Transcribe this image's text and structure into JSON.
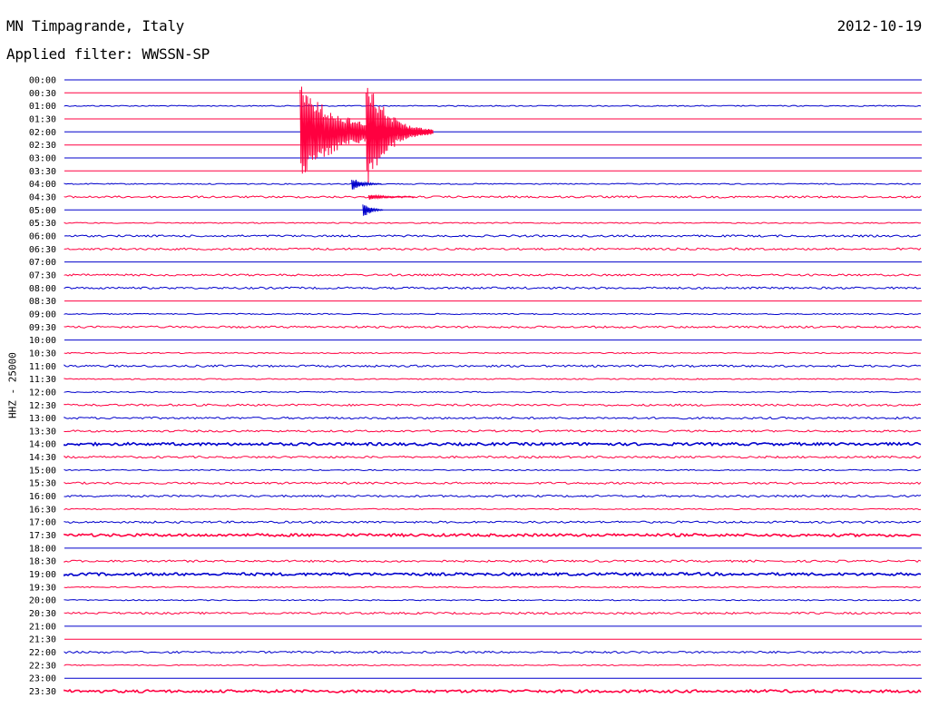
{
  "header": {
    "station": "MN Timpagrande, Italy",
    "date": "2012-10-19",
    "filter": "Applied filter: WWSSN-SP",
    "channel_label": "HHZ - 25000"
  },
  "colors": {
    "blue": "#0000cc",
    "red": "#ff0040"
  },
  "chart_data": {
    "type": "line",
    "title": "MN Timpagrande, Italy",
    "subtitle": "Applied filter: WWSSN-SP",
    "ylabel": "HHZ - 25000",
    "x": [],
    "categories": [
      "00:00",
      "00:30",
      "01:00",
      "01:30",
      "02:00",
      "02:30",
      "03:00",
      "03:30",
      "04:00",
      "04:30",
      "05:00",
      "05:30",
      "06:00",
      "06:30",
      "07:00",
      "07:30",
      "08:00",
      "08:30",
      "09:00",
      "09:30",
      "10:00",
      "10:30",
      "11:00",
      "11:30",
      "12:00",
      "12:30",
      "13:00",
      "13:30",
      "14:00",
      "14:30",
      "15:00",
      "15:30",
      "16:00",
      "16:30",
      "17:00",
      "17:30",
      "18:00",
      "18:30",
      "19:00",
      "19:30",
      "20:00",
      "20:30",
      "21:00",
      "21:30",
      "22:00",
      "22:30",
      "23:00",
      "23:30"
    ],
    "line_colors": [
      "blue",
      "red"
    ],
    "noise_levels": [
      0,
      0,
      1,
      0,
      0,
      0,
      0,
      0,
      1,
      2,
      0,
      1,
      2,
      2,
      0,
      2,
      2,
      0,
      1,
      2,
      0,
      1,
      2,
      1,
      1,
      2,
      2,
      2,
      3,
      2,
      1,
      2,
      2,
      1,
      2,
      3,
      0,
      2,
      3,
      1,
      1,
      2,
      0,
      0,
      2,
      1,
      0,
      3
    ],
    "events": [
      {
        "row": 4,
        "start": 0.275,
        "end": 0.43,
        "color": "red",
        "amplitude": 1.0
      },
      {
        "row": 4,
        "start": 0.352,
        "end": 0.43,
        "color": "red",
        "amplitude": 1.25
      },
      {
        "row": 8,
        "start": 0.335,
        "end": 0.37,
        "color": "blue",
        "amplitude": 0.15
      },
      {
        "row": 9,
        "start": 0.355,
        "end": 0.41,
        "color": "red",
        "amplitude": 0.06
      },
      {
        "row": 10,
        "start": 0.348,
        "end": 0.372,
        "color": "blue",
        "amplitude": 0.2
      }
    ]
  }
}
